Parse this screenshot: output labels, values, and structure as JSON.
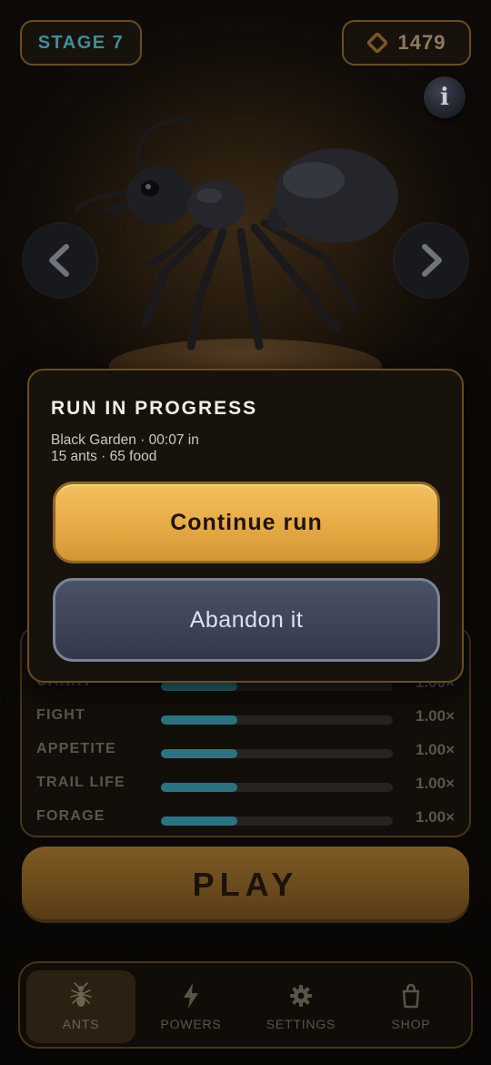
{
  "header": {
    "stage_label": "STAGE 7",
    "gem_count": "1479",
    "info_glyph": "i"
  },
  "stats": [
    {
      "label": "CARRY",
      "value": "1.00×",
      "level": 0.33
    },
    {
      "label": "FIGHT",
      "value": "1.00×",
      "level": 0.33
    },
    {
      "label": "APPETITE",
      "value": "1.00×",
      "level": 0.33
    },
    {
      "label": "TRAIL LIFE",
      "value": "1.00×",
      "level": 0.33
    },
    {
      "label": "FORAGE",
      "value": "1.00×",
      "level": 0.33
    }
  ],
  "play_label": "PLAY",
  "nav": {
    "tabs": [
      {
        "label": "ANTS",
        "icon": "ant-icon",
        "active": true
      },
      {
        "label": "POWERS",
        "icon": "lightning-icon",
        "active": false
      },
      {
        "label": "SETTINGS",
        "icon": "gear-icon",
        "active": false
      },
      {
        "label": "SHOP",
        "icon": "shopping-bag-icon",
        "active": false
      }
    ]
  },
  "modal": {
    "title": "RUN IN PROGRESS",
    "line1": "Black Garden · 00:07 in",
    "line2": "15 ants · 65 food",
    "continue_label": "Continue run",
    "abandon_label": "Abandon it"
  },
  "colors": {
    "accent_gold": "#e8ad48",
    "stage_teal": "#3f8d99",
    "bar_fill": "#2a7482",
    "abandon_slate": "#3d4356"
  }
}
